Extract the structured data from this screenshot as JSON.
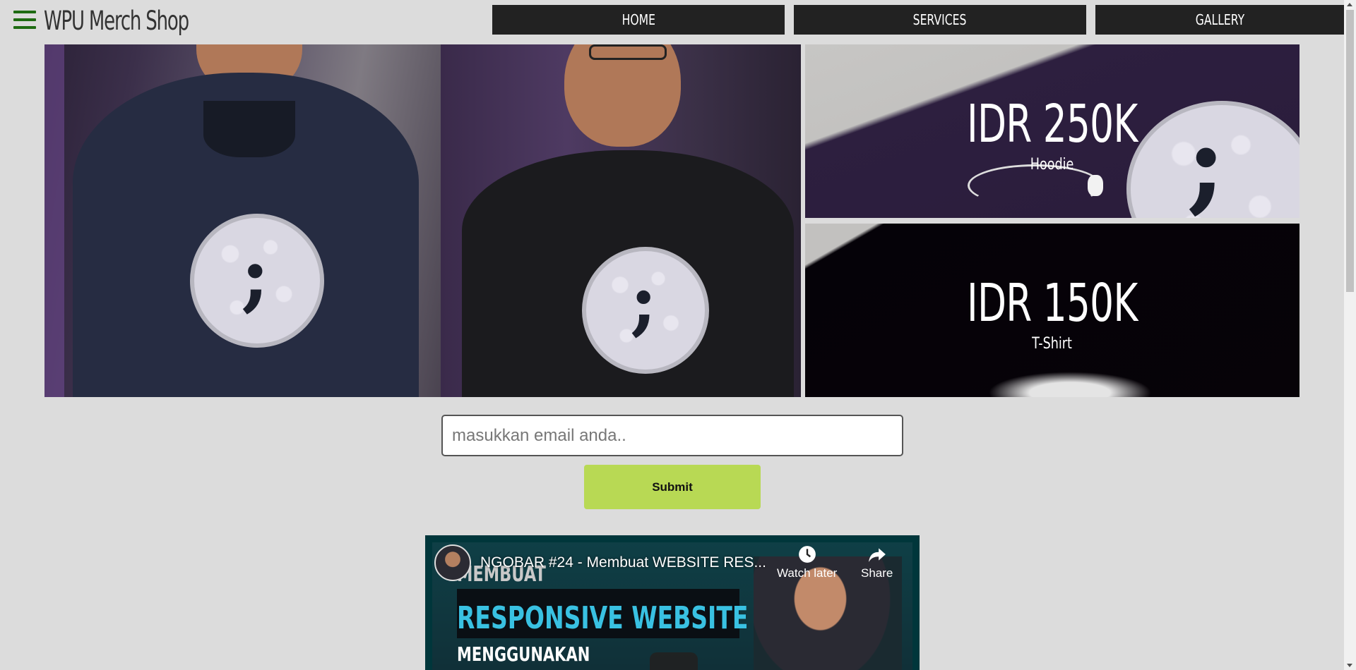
{
  "header": {
    "brand": "WPU Merch Shop",
    "menu_icon": "hamburger-menu-icon"
  },
  "nav": {
    "items": [
      {
        "label": "HOME"
      },
      {
        "label": "SERVICES"
      },
      {
        "label": "GALLERY"
      }
    ]
  },
  "products": [
    {
      "price": "IDR 250K",
      "name": "Hoodie"
    },
    {
      "price": "IDR 150K",
      "name": "T-Shirt"
    }
  ],
  "form": {
    "email_placeholder": "masukkan email anda..",
    "submit_label": "Submit"
  },
  "video": {
    "title": "NGOBAR #24 - Membuat WEBSITE RES...",
    "watch_later_label": "Watch later",
    "share_label": "Share",
    "thumb_line1": "MEMBUAT",
    "thumb_line2": "RESPONSIVE WEBSITE",
    "thumb_line3": "MENGGUNAKAN"
  },
  "colors": {
    "brand_green": "#1e6b12",
    "nav_bg": "#222222",
    "submit_bg": "#b8d954",
    "page_bg": "#dcdcdc"
  }
}
